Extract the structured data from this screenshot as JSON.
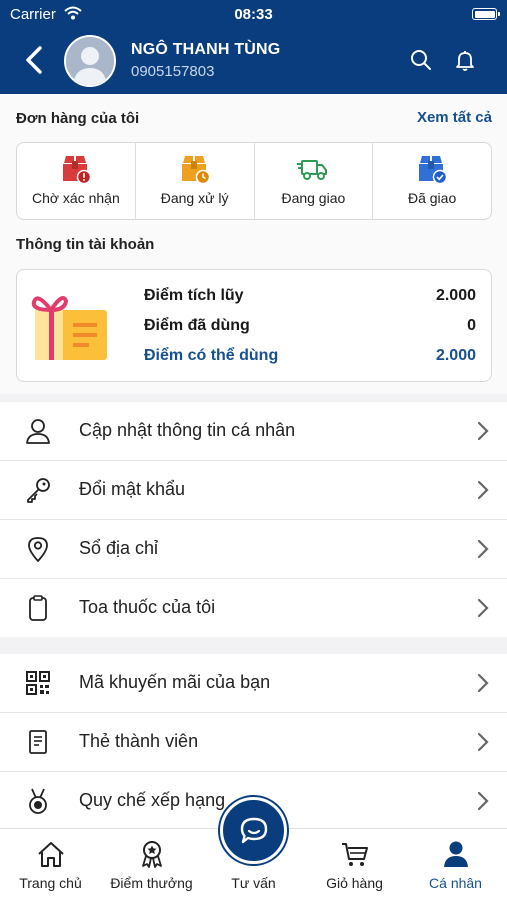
{
  "status_bar": {
    "carrier": "Carrier",
    "time": "08:33"
  },
  "profile": {
    "name": "NGÔ THANH TÙNG",
    "phone": "0905157803"
  },
  "orders": {
    "title": "Đơn hàng của tôi",
    "see_all": "Xem tất cả",
    "items": [
      {
        "label": "Chờ xác nhận",
        "icon": "box-alert-icon",
        "color": "#d93b3b"
      },
      {
        "label": "Đang xử lý",
        "icon": "box-clock-icon",
        "color": "#f0a020"
      },
      {
        "label": "Đang giao",
        "icon": "delivery-truck-icon",
        "color": "#2e9b52"
      },
      {
        "label": "Đã giao",
        "icon": "box-check-icon",
        "color": "#2f6fd6"
      }
    ]
  },
  "account": {
    "title": "Thông tin tài khoản",
    "points": [
      {
        "label": "Điểm tích lũy",
        "value": "2.000"
      },
      {
        "label": "Điểm đã dùng",
        "value": "0"
      },
      {
        "label": "Điểm có thể dùng",
        "value": "2.000"
      }
    ]
  },
  "menu_group1": [
    {
      "label": "Cập nhật thông tin cá nhân",
      "icon": "user-icon"
    },
    {
      "label": "Đổi mật khẩu",
      "icon": "key-icon"
    },
    {
      "label": "Sổ địa chỉ",
      "icon": "location-pin-icon"
    },
    {
      "label": "Toa thuốc của tôi",
      "icon": "clipboard-icon"
    }
  ],
  "menu_group2": [
    {
      "label": "Mã khuyến mãi của bạn",
      "icon": "qr-code-icon"
    },
    {
      "label": "Thẻ thành viên",
      "icon": "member-card-icon"
    },
    {
      "label": "Quy chế xếp hạng",
      "icon": "medal-icon"
    }
  ],
  "tabs": [
    {
      "label": "Trang chủ",
      "icon": "home-icon"
    },
    {
      "label": "Điểm thưởng",
      "icon": "award-ribbon-icon"
    },
    {
      "label": "Tư vấn",
      "icon": "chat-bubble-icon"
    },
    {
      "label": "Giỏ hàng",
      "icon": "cart-icon"
    },
    {
      "label": "Cá nhân",
      "icon": "person-icon",
      "active": true
    }
  ],
  "colors": {
    "primary": "#0a3d7e",
    "accent_text": "#17508f"
  }
}
